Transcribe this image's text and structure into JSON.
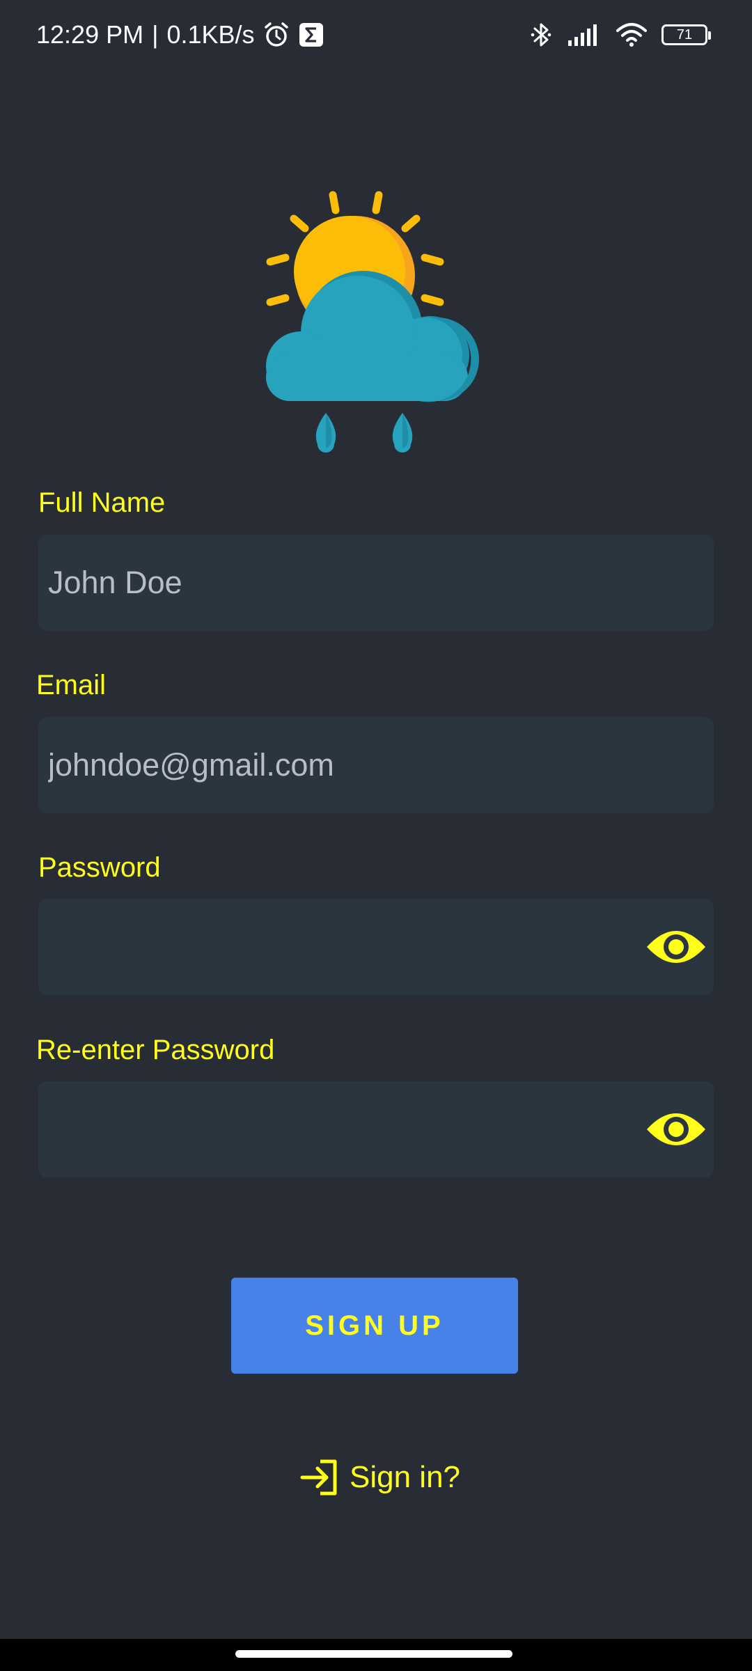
{
  "status_bar": {
    "time": "12:29 PM",
    "separator": "|",
    "network_speed": "0.1KB/s",
    "battery_level": "71",
    "icons": [
      "alarm-icon",
      "sigma-icon",
      "bluetooth-icon",
      "signal-icon",
      "wifi-icon",
      "battery-icon"
    ]
  },
  "logo": {
    "icon": "weather-sun-cloud-rain-icon"
  },
  "form": {
    "full_name": {
      "label": "Full Name",
      "placeholder": "John Doe",
      "value": ""
    },
    "email": {
      "label": "Email",
      "placeholder": "johndoe@gmail.com",
      "value": ""
    },
    "password": {
      "label": "Password",
      "value": "",
      "toggle_icon": "eye-icon"
    },
    "confirm_password": {
      "label": "Re-enter Password",
      "value": "",
      "toggle_icon": "eye-icon"
    }
  },
  "actions": {
    "signup_label": "SIGN UP",
    "signin_label": "Sign in?",
    "signin_icon": "login-arrow-icon"
  },
  "colors": {
    "background": "#282c35",
    "field_background": "#2b3540",
    "accent_text": "#ffff1a",
    "button": "#4782e8",
    "placeholder": "#b9bdc4"
  }
}
